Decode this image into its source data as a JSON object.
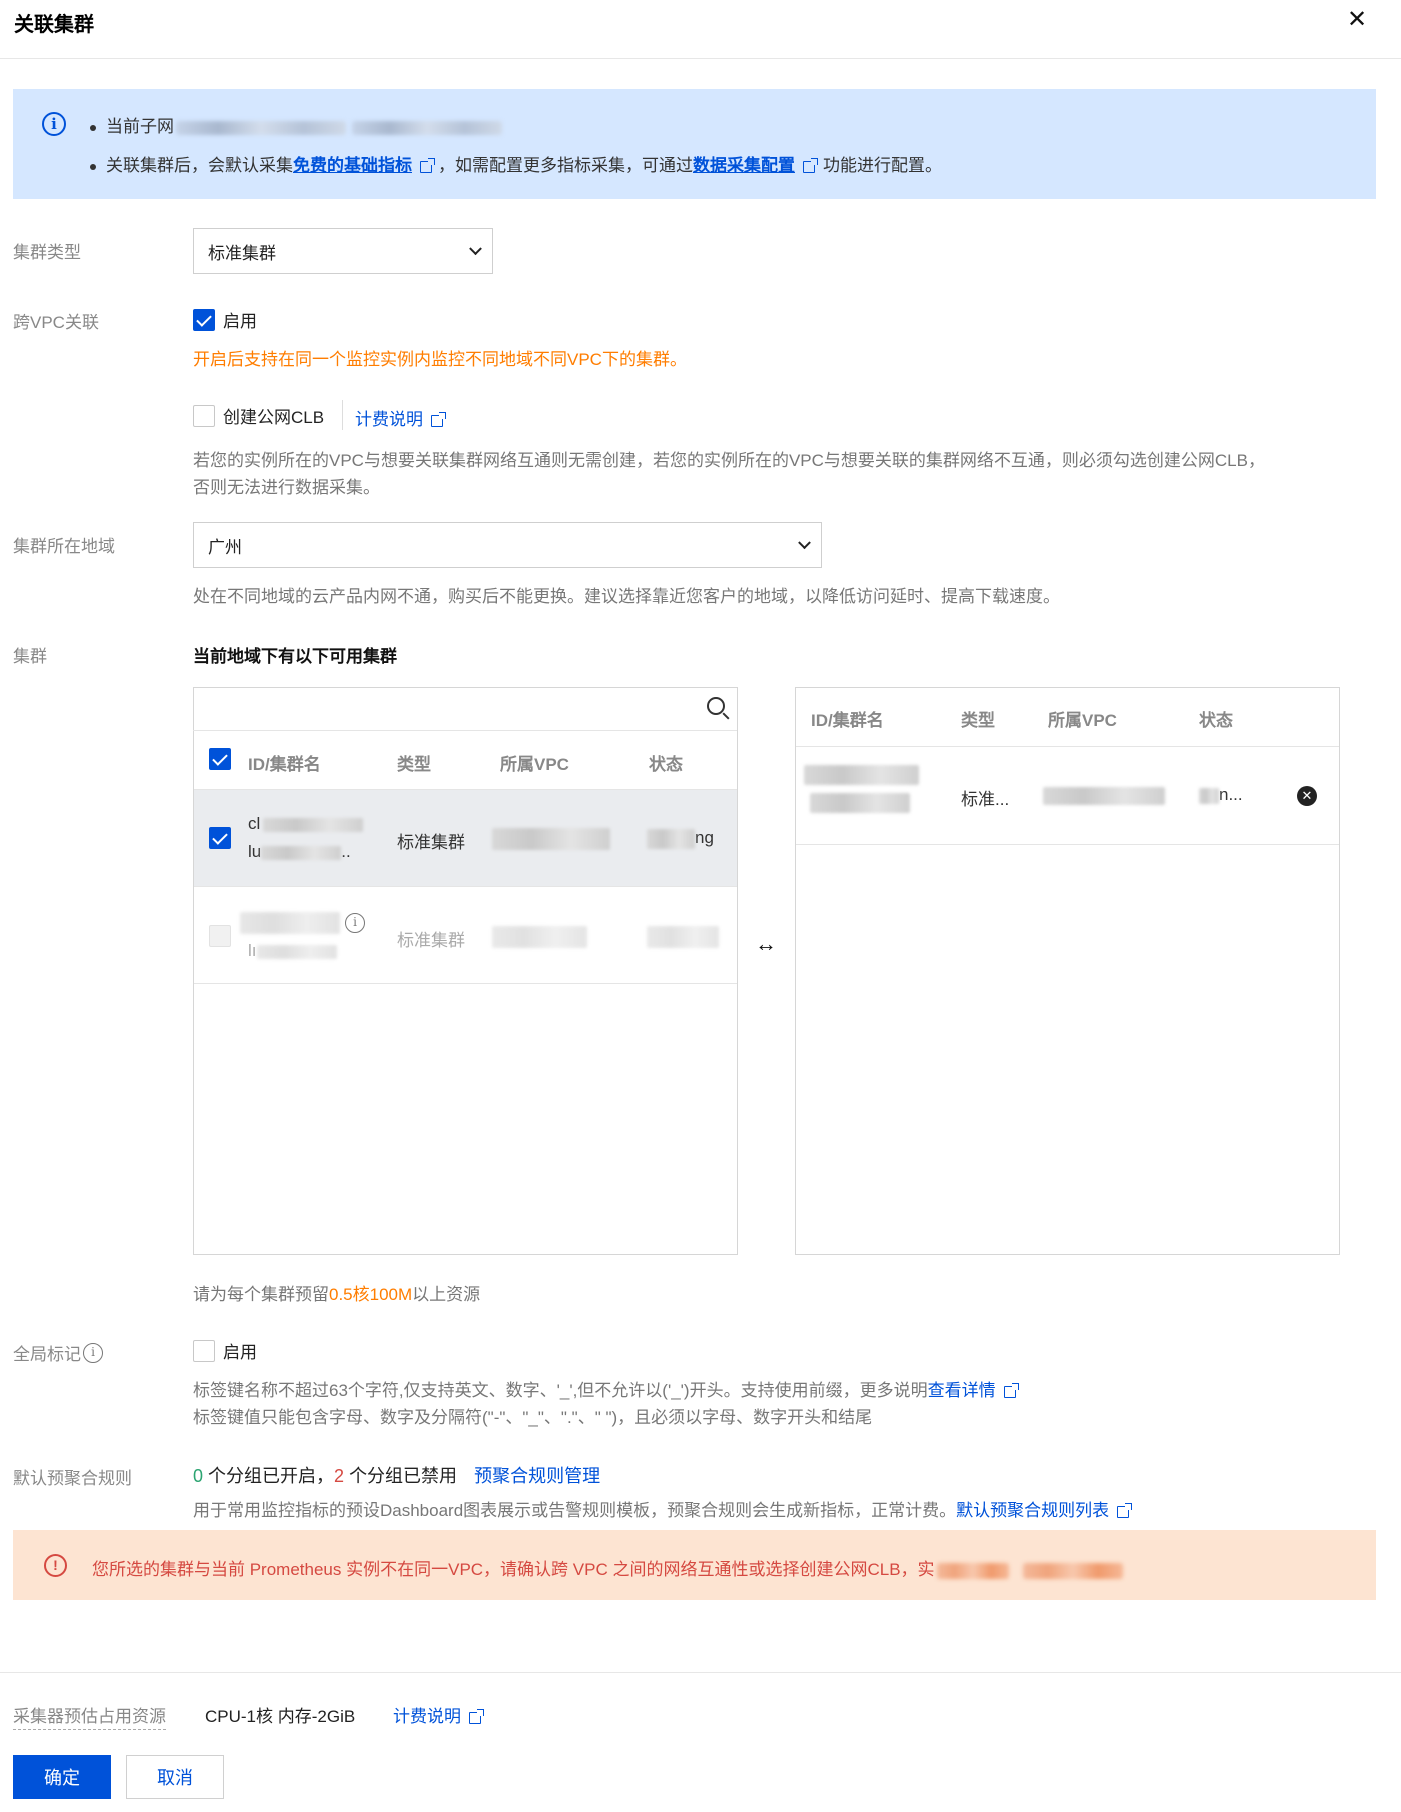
{
  "dialog": {
    "title": "关联集群"
  },
  "info": {
    "line1_prefix": "当前子网",
    "line2_a": "关联集群后，会默认采集",
    "line2_link1": "免费的基础指标",
    "line2_b": "，如需配置更多指标采集，可通过",
    "line2_link2": "数据采集配置",
    "line2_c": "功能进行配置。"
  },
  "form": {
    "cluster_type": {
      "label": "集群类型",
      "value": "标准集群"
    },
    "cross_vpc": {
      "label": "跨VPC关联",
      "option": "启用",
      "checked": true,
      "warning": "开启后支持在同一个监控实例内监控不同地域不同VPC下的集群。",
      "clb_label": "创建公网CLB",
      "clb_link": "计费说明",
      "clb_hint_1": "若您的实例所在的VPC与想要关联集群网络互通则无需创建，若您的实例所在的VPC与想要关联的集群网络不互通，则必须勾选创建公网CLB，",
      "clb_hint_2": "否则无法进行数据采集。"
    },
    "region": {
      "label": "集群所在地域",
      "value": "广州",
      "hint": "处在不同地域的云产品内网不通，购买后不能更换。建议选择靠近您客户的地域，以降低访问延时、提高下载速度。"
    },
    "cluster": {
      "label": "集群",
      "subtitle": "当前地域下有以下可用集群",
      "columns": [
        "ID/集群名",
        "类型",
        "所属VPC",
        "状态"
      ],
      "left_rows": [
        {
          "id_prefix": "cl",
          "name_prefix": "lu",
          "name_suffix": "..",
          "type": "标准集群",
          "status_suffix": "ng",
          "selected": true
        },
        {
          "name_prefix": "lı",
          "type": "标准集群",
          "selected": false,
          "disabled": true
        }
      ],
      "right_rows": [
        {
          "type": "标准...",
          "status": "n..."
        }
      ],
      "resource_hint_a": "请为每个集群预留",
      "resource_hint_value": "0.5核100M",
      "resource_hint_b": "以上资源"
    },
    "global_label": {
      "label": "全局标记",
      "option": "启用",
      "hint_1": "标签键名称不超过63个字符,仅支持英文、数字、'_',但不允许以('_')开头。支持使用前缀，更多说明",
      "hint_1_link": "查看详情",
      "hint_2": "标签键值只能包含字母、数字及分隔符(\"-\"、\"_\"、\".\"、\" \")，且必须以字母、数字开头和结尾"
    },
    "agg_rules": {
      "label": "默认预聚合规则",
      "enabled_count": "0",
      "enabled_text": "个分组已开启，",
      "disabled_count": "2",
      "disabled_text": "个分组已禁用",
      "manage_link": "预聚合规则管理",
      "hint": "用于常用监控指标的预设Dashboard图表展示或告警规则模板，预聚合规则会生成新指标，正常计费。",
      "hint_link": "默认预聚合规则列表"
    }
  },
  "warning": {
    "text": "您所选的集群与当前 Prometheus 实例不在同一VPC，请确认跨 VPC 之间的网络互通性或选择创建公网CLB，实"
  },
  "footer": {
    "resource_label": "采集器预估占用资源",
    "resource_value": "CPU-1核 内存-2GiB",
    "billing_link": "计费说明",
    "confirm": "确定",
    "cancel": "取消"
  },
  "colors": {
    "primary": "#0052d9",
    "warning_text": "#ff7d00",
    "error": "#d54941",
    "success": "#2ba471"
  }
}
